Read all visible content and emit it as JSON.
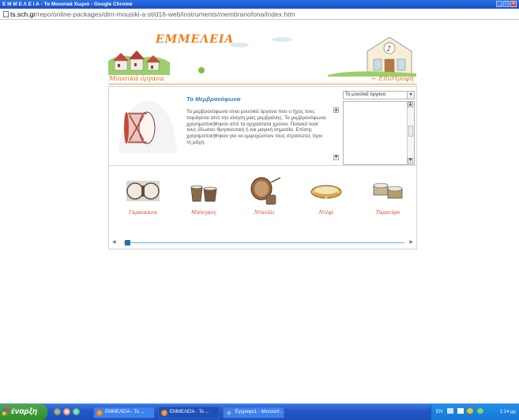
{
  "window": {
    "title": "Ε Μ Μ Ε Λ Ε Ι Α - Τα Μουσικά Χωριό - Google Chrome",
    "url_host": "ts.sch.gr",
    "url_path": "/repo/online-packages/dim-mousiki-a-st/d16-web/instruments/membranofona/index.htm"
  },
  "header": {
    "logo": "ΕΜΜΕΛΕΙΑ",
    "nav_left": "Μουσικά όργανα",
    "nav_right": "← Επιστροφή"
  },
  "main": {
    "heading": "Τα Μεμβρανόφωνα",
    "description": "Τα μεμβρανόφωνα είναι μουσικά όργανα που ο ήχος τους παράγεται από την κίνηση μιας μεμβράνης. Τα μεμβρανόφωνα χρησιμοποιήθηκαν από τα αρχαιότατα χρόνια. Παλαιοί λαοί τους έδωσαν θρησκευτική ή και μαγική σημασία. Επίσης χρησιμοποιήθηκαν για να εμψυχώσουν τους στρατιώτες πριν τη μάχη.",
    "select_value": "Τα μουσικά όργανα"
  },
  "gallery": [
    {
      "label": "Γκρανκάσα",
      "icon": "bass-drum-icon"
    },
    {
      "label": "Μπόνγκος",
      "icon": "bongos-icon"
    },
    {
      "label": "Νταούλι",
      "icon": "daouli-icon"
    },
    {
      "label": "Ντέφι",
      "icon": "tambourine-icon"
    },
    {
      "label": "Ταμπούρο",
      "icon": "snare-drum-icon"
    }
  ],
  "taskbar": {
    "start_label": "έναρξη",
    "tasks": [
      "ΕΜΜΕΛΕΙΑ - Το ...",
      "ΕΜΜΕΛΕΙΑ - Το ...",
      "Έγγραφο1 - Microsof..."
    ],
    "tray_lang": "EN",
    "clock": "1:14 μμ"
  },
  "colors": {
    "accent_orange": "#e2711d",
    "heading_blue": "#2f7fb8",
    "caption_red": "#d4442a"
  }
}
